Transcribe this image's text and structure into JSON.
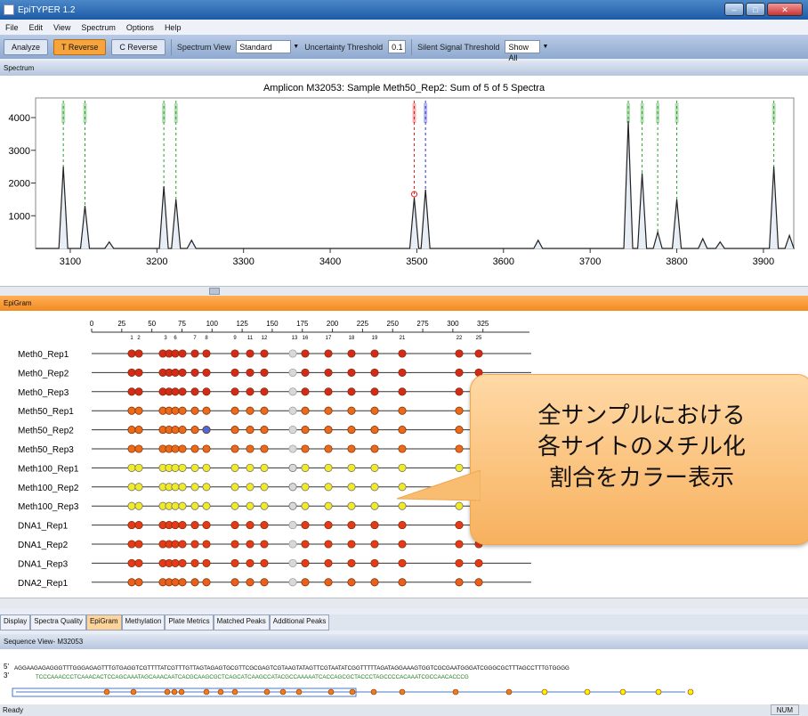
{
  "app": {
    "title": "EpiTYPER 1.2"
  },
  "menu": [
    "File",
    "Edit",
    "View",
    "Spectrum",
    "Options",
    "Help"
  ],
  "toolbar": {
    "analyze": "Analyze",
    "treverse": "T Reverse",
    "creverse": "C Reverse",
    "spectrum_view_label": "Spectrum View",
    "spectrum_view_value": "Standard",
    "uncertainty_label": "Uncertainty Threshold",
    "uncertainty_value": "0.1",
    "silent_label": "Silent Signal Threshold",
    "silent_value": "Show All"
  },
  "panels": {
    "spectrum": "Spectrum",
    "epigram": "EpiGram",
    "sequence": "Sequence View- M32053"
  },
  "chart_data": {
    "type": "line",
    "title": "Amplicon M32053: Sample Meth50_Rep2: Sum of 5 of 5 Spectra",
    "x_ticks": [
      3100,
      3200,
      3300,
      3400,
      3500,
      3600,
      3700,
      3800,
      3900
    ],
    "y_ticks": [
      1000,
      2000,
      3000,
      4000
    ],
    "xlim": [
      3060,
      3935
    ],
    "ylim": [
      0,
      4600
    ],
    "peaks": [
      {
        "x": 3092,
        "y": 2500
      },
      {
        "x": 3117,
        "y": 1300
      },
      {
        "x": 3208,
        "y": 1900
      },
      {
        "x": 3222,
        "y": 1500
      },
      {
        "x": 3497,
        "y": 1550
      },
      {
        "x": 3510,
        "y": 1800
      },
      {
        "x": 3744,
        "y": 3900
      },
      {
        "x": 3760,
        "y": 2300
      },
      {
        "x": 3778,
        "y": 500
      },
      {
        "x": 3800,
        "y": 1500
      },
      {
        "x": 3912,
        "y": 2500
      }
    ],
    "minor_peaks": [
      {
        "x": 3145,
        "y": 200
      },
      {
        "x": 3240,
        "y": 250
      },
      {
        "x": 3640,
        "y": 250
      },
      {
        "x": 3830,
        "y": 300
      },
      {
        "x": 3850,
        "y": 200
      },
      {
        "x": 3930,
        "y": 400
      }
    ],
    "markers": [
      {
        "x": 3092,
        "color": "green"
      },
      {
        "x": 3117,
        "color": "green"
      },
      {
        "x": 3208,
        "color": "green"
      },
      {
        "x": 3222,
        "color": "green"
      },
      {
        "x": 3497,
        "color": "red"
      },
      {
        "x": 3510,
        "color": "blue"
      },
      {
        "x": 3744,
        "color": "green"
      },
      {
        "x": 3760,
        "color": "green"
      },
      {
        "x": 3778,
        "color": "green"
      },
      {
        "x": 3800,
        "color": "green"
      },
      {
        "x": 3912,
        "color": "green"
      }
    ]
  },
  "epigram": {
    "ruler": [
      0,
      25,
      50,
      75,
      100,
      125,
      150,
      175,
      200,
      225,
      250,
      275,
      300,
      325
    ],
    "sites": [
      "1",
      "2",
      "3",
      "6",
      "7",
      "8",
      "9",
      "11",
      "12",
      "13",
      "16",
      "17",
      "18",
      "19",
      "21",
      "22",
      "25"
    ],
    "samples": [
      "Meth0_Rep1",
      "Meth0_Rep2",
      "Meth0_Rep3",
      "Meth50_Rep1",
      "Meth50_Rep2",
      "Meth50_Rep3",
      "Meth100_Rep1",
      "Meth100_Rep2",
      "Meth100_Rep3",
      "DNA1_Rep1",
      "DNA1_Rep2",
      "DNA1_Rep3",
      "DNA2_Rep1"
    ],
    "colors": {
      "Meth0": "#d42a1a",
      "Meth50": "#ea6a1a",
      "Meth100": "#f1ea2a",
      "DNA1": "#e43a1a",
      "DNA2": "#e8601a"
    }
  },
  "callout": {
    "line1": "全サンプルにおける",
    "line2": "各サイトのメチル化",
    "line3": "割合をカラー表示"
  },
  "tabs": [
    "Display",
    "Spectra Quality",
    "EpiGram",
    "Methylation",
    "Plate Metrics",
    "Matched Peaks",
    "Additional Peaks"
  ],
  "sequence": {
    "seq_top": "AGGAAGAGAGGGTTTGGGAGAGTTTGTGAGGTCGTTTTATCGTTTGTTAGTAGAGTGCGTTCGCGAGTCGTAAGTATAGTTCGTAATATCGGTTTTTAGATAGGAAAGTGGTCGCGAATGGGATCGGGCGCTTTAGCCTTTGTGGGG",
    "seq_bottom": "TCCCAAACCCTCAAACACTCCAGCAAATAGCAAACAATCACGCAAGCGCTCAGCATCAAGCCATACGCCAAAAATCACCAGCGCTACCCTAGCCCCACAAATCGCCAACACCCG"
  },
  "status": {
    "left": "Ready",
    "right": "NUM"
  }
}
